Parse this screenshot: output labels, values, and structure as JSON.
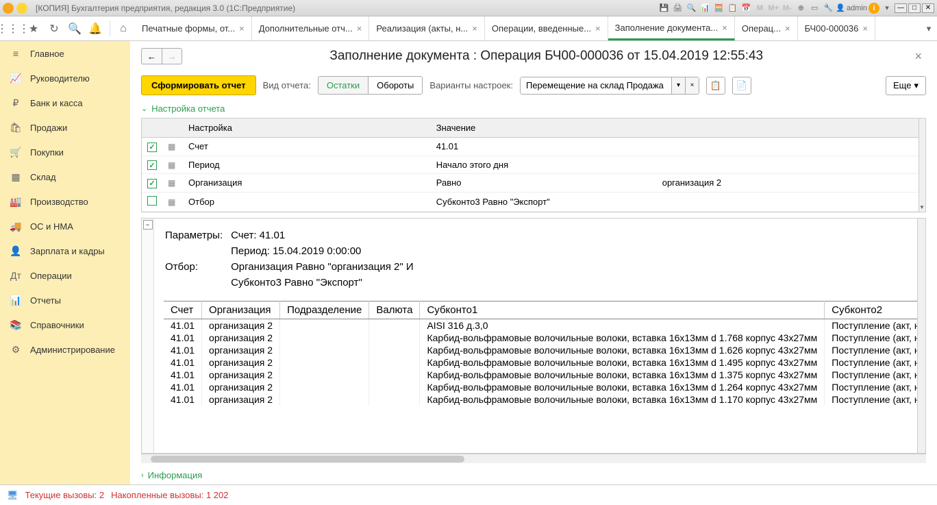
{
  "titlebar": {
    "title": "[КОПИЯ] Бухгалтерия предприятия, редакция 3.0  (1С:Предприятие)",
    "user": "admin"
  },
  "tabs": [
    {
      "label": "Печатные формы, от...",
      "active": false
    },
    {
      "label": "Дополнительные отч...",
      "active": false
    },
    {
      "label": "Реализация (акты, н...",
      "active": false
    },
    {
      "label": "Операции, введенные...",
      "active": false
    },
    {
      "label": "Заполнение документа...",
      "active": true
    },
    {
      "label": "Операц...",
      "active": false
    },
    {
      "label": "БЧ00-000036",
      "active": false
    }
  ],
  "sidebar": [
    {
      "icon": "menu",
      "label": "Главное"
    },
    {
      "icon": "chart",
      "label": "Руководителю"
    },
    {
      "icon": "bank",
      "label": "Банк и касса"
    },
    {
      "icon": "bag",
      "label": "Продажи"
    },
    {
      "icon": "cart",
      "label": "Покупки"
    },
    {
      "icon": "boxes",
      "label": "Склад"
    },
    {
      "icon": "factory",
      "label": "Производство"
    },
    {
      "icon": "truck",
      "label": "ОС и НМА"
    },
    {
      "icon": "person",
      "label": "Зарплата и кадры"
    },
    {
      "icon": "dtkt",
      "label": "Операции"
    },
    {
      "icon": "bars",
      "label": "Отчеты"
    },
    {
      "icon": "book",
      "label": "Справочники"
    },
    {
      "icon": "gear",
      "label": "Администрирование"
    }
  ],
  "page": {
    "title": "Заполнение документа : Операция БЧ00-000036 от 15.04.2019 12:55:43",
    "form_report_btn": "Сформировать отчет",
    "report_type_label": "Вид отчета:",
    "report_type_options": [
      "Остатки",
      "Обороты"
    ],
    "variants_label": "Варианты настроек:",
    "variants_value": "Перемещение на склад Продажа",
    "more_btn": "Еще"
  },
  "sections": {
    "settings": "Настройка отчета",
    "info": "Информация"
  },
  "settings_table": {
    "headers": [
      "Настройка",
      "Значение"
    ],
    "rows": [
      {
        "checked": true,
        "name": "Счет",
        "value": "41.01",
        "value2": ""
      },
      {
        "checked": true,
        "name": "Период",
        "value": "Начало этого дня",
        "value2": ""
      },
      {
        "checked": true,
        "name": "Организация",
        "value": "Равно",
        "value2": "организация 2"
      },
      {
        "checked": false,
        "name": "Отбор",
        "value": "Субконто3 Равно \"Экспорт\"",
        "value2": ""
      }
    ]
  },
  "report": {
    "params_label": "Параметры:",
    "filter_label": "Отбор:",
    "params": [
      "Счет: 41.01",
      "Период: 15.04.2019 0:00:00"
    ],
    "filters": [
      "Организация Равно \"организация 2\" И",
      "Субконто3 Равно \"Экспорт\""
    ],
    "columns": [
      "Счет",
      "Организация",
      "Подразделение",
      "Валюта",
      "Субконто1",
      "Субконто2"
    ],
    "rows": [
      {
        "acct": "41.01",
        "org": "организация 2",
        "dept": "",
        "cur": "",
        "sub1": "AISI 316 д.3,0",
        "sub2": "Поступление (акт, н"
      },
      {
        "acct": "41.01",
        "org": "организация 2",
        "dept": "",
        "cur": "",
        "sub1": "Карбид-вольфрамовые волочильные волоки, вставка 16х13мм d 1.768 корпус 43х27мм",
        "sub2": "Поступление (акт, н"
      },
      {
        "acct": "41.01",
        "org": "организация 2",
        "dept": "",
        "cur": "",
        "sub1": "Карбид-вольфрамовые волочильные волоки, вставка 16х13мм d 1.626 корпус 43х27мм",
        "sub2": "Поступление (акт, н"
      },
      {
        "acct": "41.01",
        "org": "организация 2",
        "dept": "",
        "cur": "",
        "sub1": "Карбид-вольфрамовые волочильные волоки, вставка 16х13мм d 1.495 корпус 43х27мм",
        "sub2": "Поступление (акт, н"
      },
      {
        "acct": "41.01",
        "org": "организация 2",
        "dept": "",
        "cur": "",
        "sub1": "Карбид-вольфрамовые волочильные волоки, вставка 16х13мм d 1.375 корпус 43х27мм",
        "sub2": "Поступление (акт, н"
      },
      {
        "acct": "41.01",
        "org": "организация 2",
        "dept": "",
        "cur": "",
        "sub1": "Карбид-вольфрамовые волочильные волоки, вставка 16х13мм d 1.264 корпус 43х27мм",
        "sub2": "Поступление (акт, н"
      },
      {
        "acct": "41.01",
        "org": "организация 2",
        "dept": "",
        "cur": "",
        "sub1": "Карбид-вольфрамовые волочильные волоки, вставка 16х13мм d 1.170 корпус 43х27мм",
        "sub2": "Поступление (акт, н"
      }
    ]
  },
  "statusbar": {
    "current": "Текущие вызовы:  2",
    "accumulated": "Накопленные вызовы: 1 202"
  }
}
